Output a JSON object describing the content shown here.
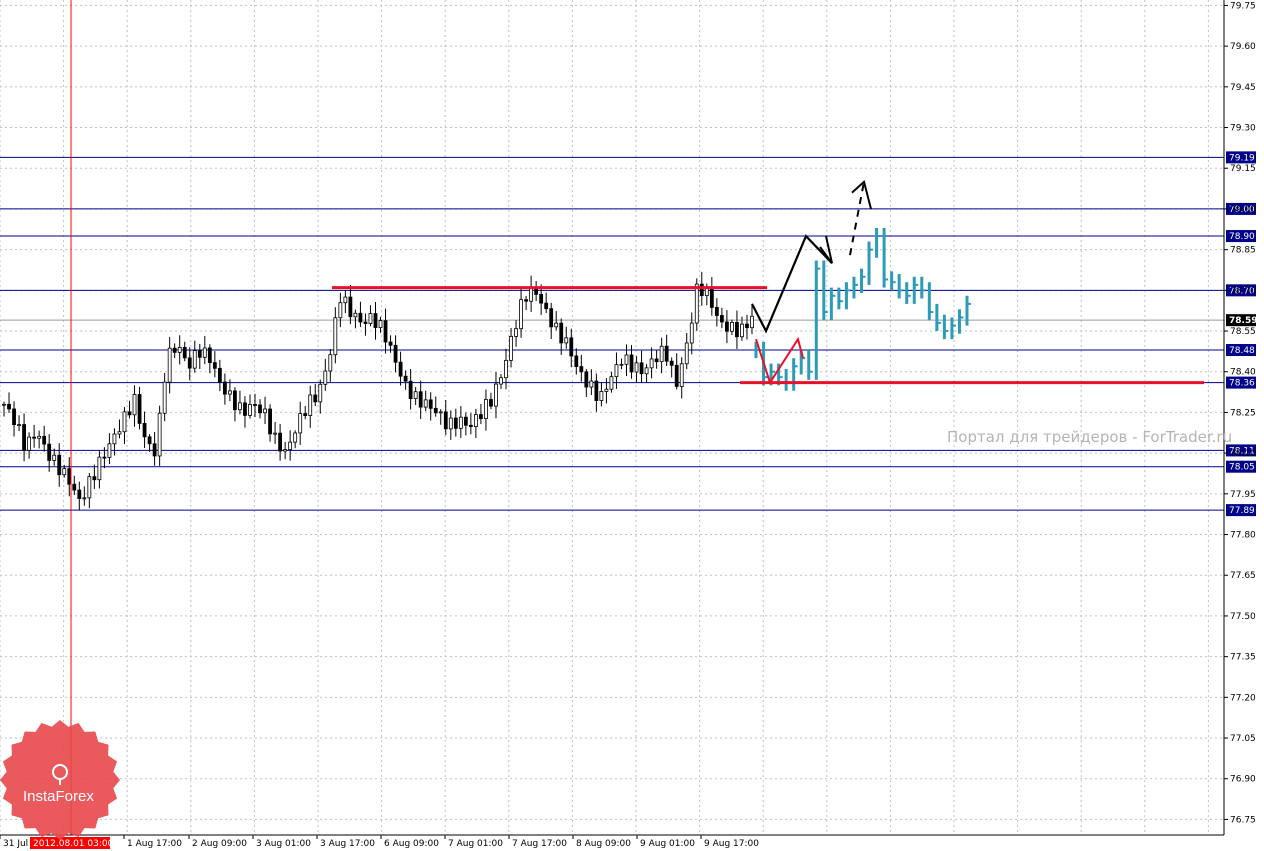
{
  "watermark": "Портал для трейдеров - ForTrader.ru",
  "brand": {
    "name": "InstaForex",
    "color": "#e8474a"
  },
  "colors": {
    "grid": "#b9c2cc",
    "candles": "#000000",
    "levels": "#00008b",
    "resistance": "#e8102a",
    "forecast": "#2c9bb6",
    "cursor": "#ff0000",
    "current_price_bg": "#000000"
  },
  "chart_data": {
    "type": "candlestick",
    "symbol_note": "",
    "ylim": [
      76.7,
      79.77
    ],
    "y_ticks": [
      "79.75",
      "79.60",
      "79.45",
      "79.30",
      "79.15",
      "79.00",
      "78.85",
      "78.70",
      "78.55",
      "78.40",
      "78.25",
      "78.10",
      "77.95",
      "77.80",
      "77.65",
      "77.50",
      "77.35",
      "77.20",
      "77.05",
      "76.90",
      "76.75"
    ],
    "x_labels": [
      "31 Jul 0",
      "2012.08.01 03:00",
      "1 Aug 17:00",
      "2 Aug 09:00",
      "3 Aug 01:00",
      "3 Aug 17:00",
      "6 Aug 09:00",
      "7 Aug 01:00",
      "7 Aug 17:00",
      "8 Aug 09:00",
      "9 Aug 01:00",
      "9 Aug 17:00"
    ],
    "cursor_time": "2012.08.01 03:00",
    "horizontal_levels": [
      "79.19",
      "79.00",
      "78.90",
      "78.70",
      "78.48",
      "78.36",
      "78.11",
      "78.05",
      "77.89"
    ],
    "current_price": "78.59",
    "resistance_level": 78.71,
    "support_level": 78.36,
    "close_path": [
      78.28,
      78.22,
      78.12,
      78.18,
      78.1,
      78.05,
      78.0,
      77.92,
      78.0,
      78.08,
      78.15,
      78.22,
      78.3,
      78.15,
      78.1,
      78.45,
      78.5,
      78.42,
      78.48,
      78.45,
      78.35,
      78.3,
      78.25,
      78.28,
      78.25,
      78.15,
      78.1,
      78.2,
      78.28,
      78.32,
      78.45,
      78.68,
      78.62,
      78.58,
      78.6,
      78.55,
      78.45,
      78.35,
      78.3,
      78.28,
      78.25,
      78.2,
      78.22,
      78.2,
      78.25,
      78.3,
      78.4,
      78.55,
      78.68,
      78.7,
      78.62,
      78.55,
      78.5,
      78.4,
      78.35,
      78.3,
      78.38,
      78.45,
      78.42,
      78.4,
      78.45,
      78.48,
      78.35,
      78.5,
      78.72,
      78.68,
      78.58,
      78.56,
      78.55,
      78.6
    ],
    "forecast_path": [
      78.48,
      78.38,
      78.4,
      78.38,
      78.36,
      78.42,
      78.45,
      78.4,
      78.78,
      78.62,
      78.68,
      78.66,
      78.7,
      78.72,
      78.75,
      78.85,
      78.9,
      78.74,
      78.73,
      78.7,
      78.68,
      78.72,
      78.7,
      78.62,
      78.58,
      78.55,
      78.57,
      78.6,
      78.65
    ]
  }
}
